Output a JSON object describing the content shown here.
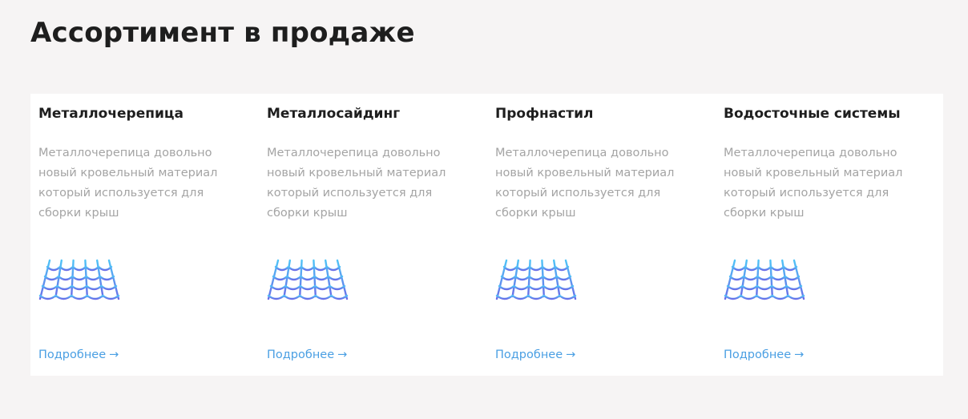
{
  "section": {
    "title": "Ассортимент в продаже"
  },
  "cards": [
    {
      "title": "Металлочерепица",
      "description": "Металлочерепица довольно новый кровельный материал который используется для сборки крыш",
      "icon": "metal-tile-roof-icon",
      "link_label": "Подробнее",
      "link_arrow": "→"
    },
    {
      "title": "Металлосайдинг",
      "description": "Металлочерепица довольно новый кровельный материал который используется для сборки крыш",
      "icon": "metal-tile-roof-icon",
      "link_label": "Подробнее",
      "link_arrow": "→"
    },
    {
      "title": "Профнастил",
      "description": "Металлочерепица довольно новый кровельный материал который используется для сборки крыш",
      "icon": "metal-tile-roof-icon",
      "link_label": "Подробнее",
      "link_arrow": "→"
    },
    {
      "title": "Водосточные системы",
      "description": "Металлочерепица довольно новый кровельный материал который используется для сборки крыш",
      "icon": "metal-tile-roof-icon",
      "link_label": "Подробнее",
      "link_arrow": "→"
    }
  ],
  "colors": {
    "background": "#f6f4f4",
    "card": "#ffffff",
    "title": "#1e1e1e",
    "description": "#a4a4a4",
    "link": "#4a9fe3",
    "icon_gradient_top": "#4fc3f7",
    "icon_gradient_bottom": "#6a6ee8"
  }
}
